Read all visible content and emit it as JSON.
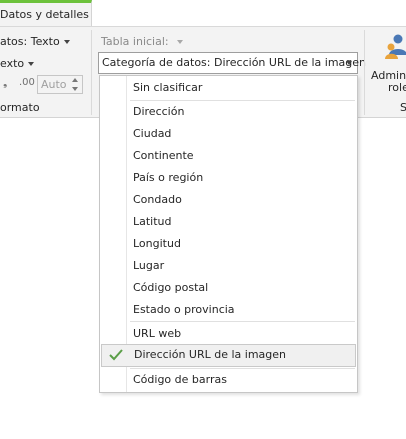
{
  "tabs": {
    "active_label": "Datos y detalles"
  },
  "ribbon": {
    "format_label": "atos: Texto",
    "type_label": "exto",
    "decimals_value": "Auto",
    "group_format": "ormato",
    "table_label": "Tabla inicial:",
    "category_combo": "Categoría de datos: Dirección URL de la imagen",
    "admin_label_1": "Admini",
    "admin_label_2": "role",
    "group_s": "S"
  },
  "menu": {
    "items": [
      "Sin clasificar",
      "Dirección",
      "Ciudad",
      "Continente",
      "País o región",
      "Condado",
      "Latitud",
      "Longitud",
      "Lugar",
      "Código postal",
      "Estado o provincia",
      "URL web",
      "Dirección URL de la imagen",
      "Código de barras"
    ],
    "checked_index": 12
  },
  "colors": {
    "tab_accent": "#6dc23c",
    "check": "#5a9e47",
    "person_icon": "#4a78b5"
  }
}
